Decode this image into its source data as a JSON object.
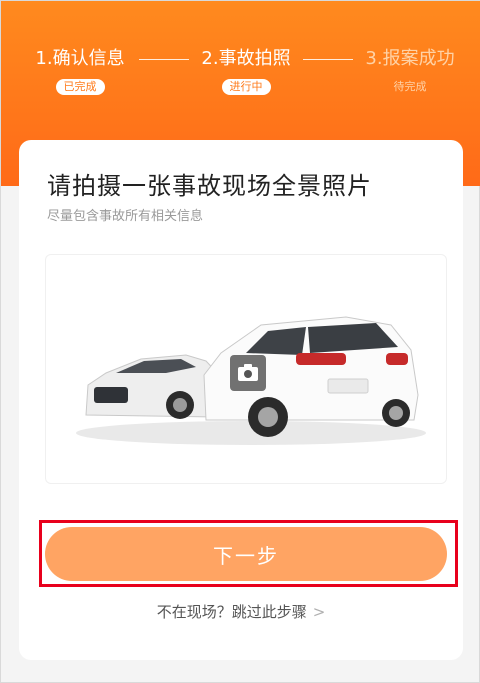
{
  "steps": [
    {
      "label": "1.确认信息",
      "status": "已完成"
    },
    {
      "label": "2.事故拍照",
      "status": "进行中"
    },
    {
      "label": "3.报案成功",
      "status": "待完成"
    }
  ],
  "card": {
    "title": "请拍摄一张事故现场全景照片",
    "subtitle": "尽量包含事故所有相关信息"
  },
  "next_button": "下一步",
  "skip_link": "不在现场？跳过此步骤",
  "colors": {
    "accent": "#ff7a1a",
    "button": "#ffa463",
    "highlight": "#e8001c"
  }
}
